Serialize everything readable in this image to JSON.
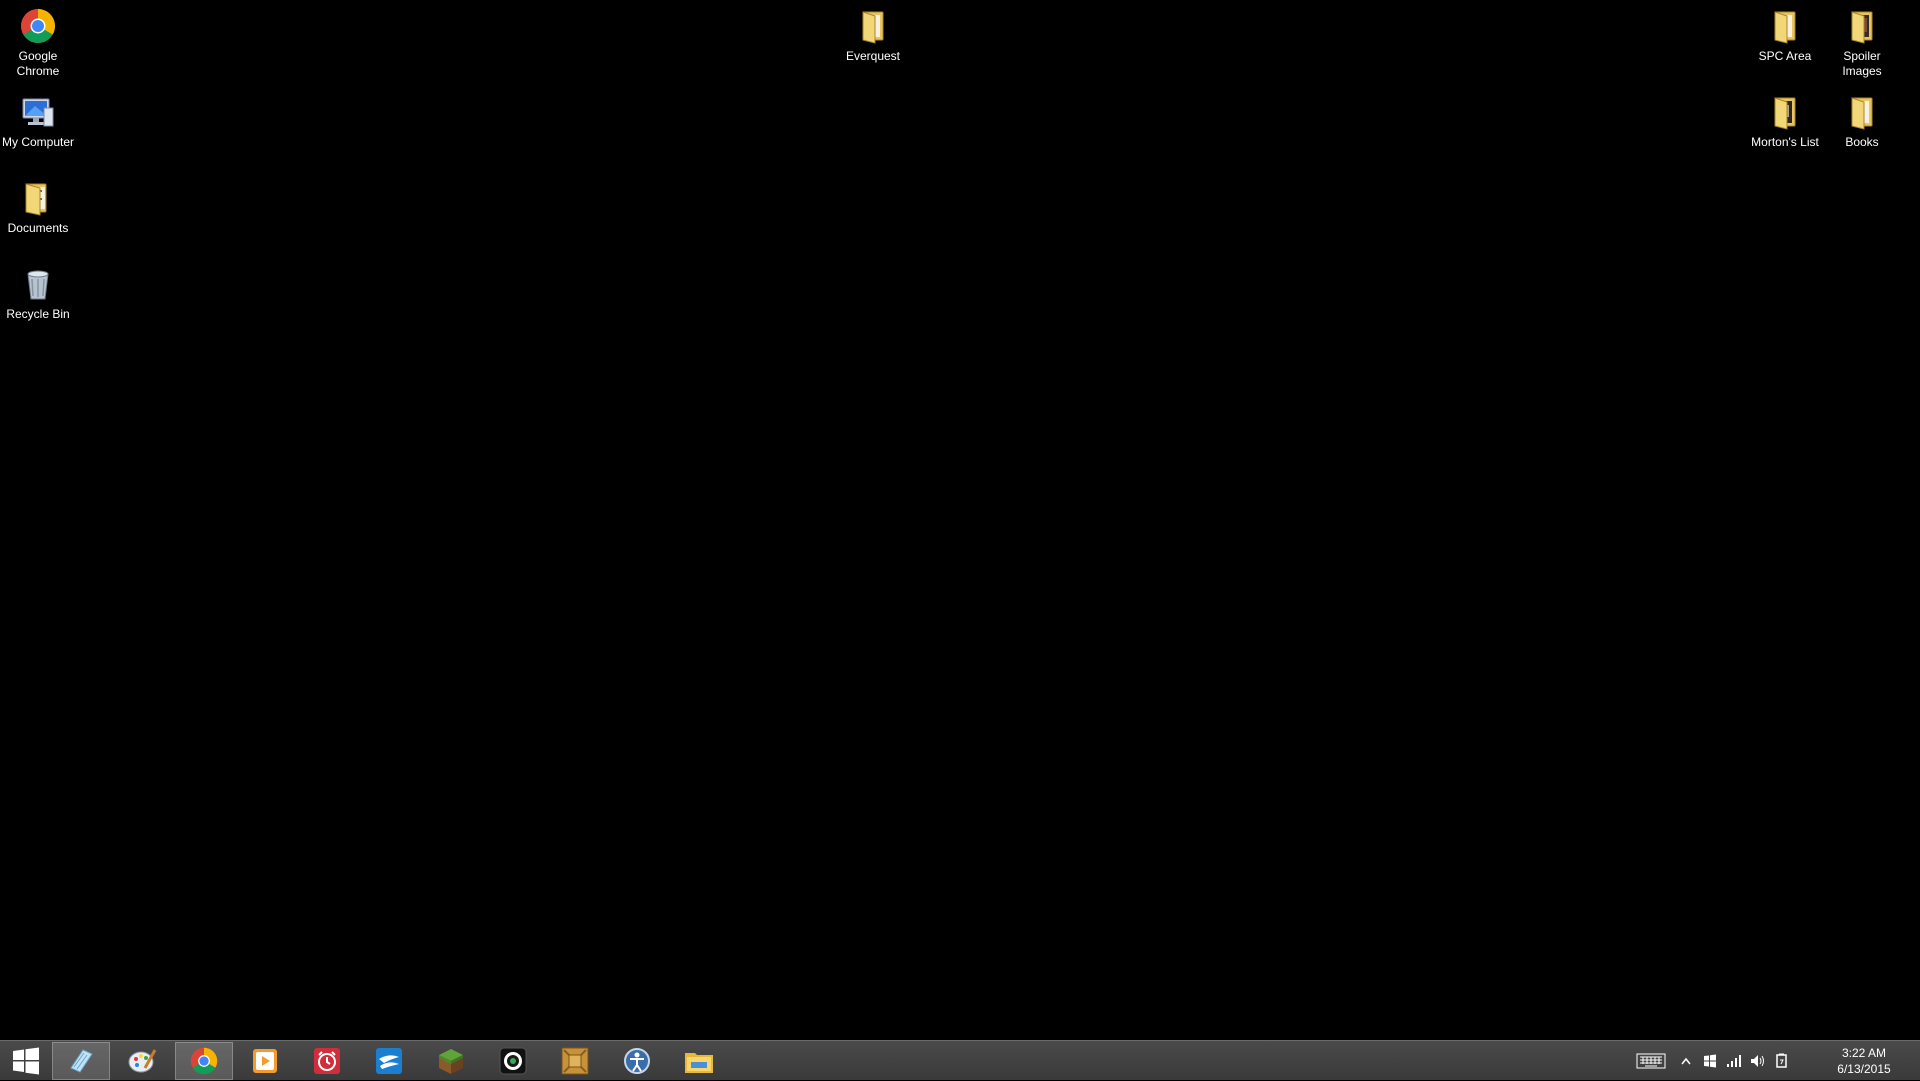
{
  "desktop": {
    "background_color": "#000000",
    "icons": {
      "google_chrome": {
        "label": "Google Chrome",
        "icon": "chrome-icon"
      },
      "my_computer": {
        "label": "My Computer",
        "icon": "computer-icon"
      },
      "documents": {
        "label": "Documents",
        "icon": "folder-icon"
      },
      "recycle_bin": {
        "label": "Recycle Bin",
        "icon": "recycle-bin-icon"
      },
      "everquest": {
        "label": "Everquest",
        "icon": "folder-icon"
      },
      "spc_area": {
        "label": "SPC Area",
        "icon": "folder-icon"
      },
      "spoiler_images": {
        "label": "Spoiler Images",
        "icon": "folder-icon"
      },
      "mortons_list": {
        "label": "Morton's List",
        "icon": "folder-icon"
      },
      "books": {
        "label": "Books",
        "icon": "folder-icon"
      }
    }
  },
  "taskbar": {
    "apps": [
      {
        "icon": "notepad-icon",
        "active": true
      },
      {
        "icon": "paint-icon",
        "active": false
      },
      {
        "icon": "chrome-icon",
        "active": true
      },
      {
        "icon": "media-player-icon",
        "active": false
      },
      {
        "icon": "alarm-clock-icon",
        "active": false
      },
      {
        "icon": "thunderbird-icon",
        "active": false
      },
      {
        "icon": "minecraft-icon",
        "active": false
      },
      {
        "icon": "camera-app-icon",
        "active": false
      },
      {
        "icon": "dosbox-icon",
        "active": false
      },
      {
        "icon": "ease-of-access-icon",
        "active": false
      },
      {
        "icon": "file-explorer-icon",
        "active": false
      }
    ],
    "tray": {
      "icons": [
        "keyboard-icon",
        "show-hidden-icons-icon",
        "action-center-icon",
        "network-signal-icon",
        "volume-icon",
        "power-icon"
      ],
      "time": "3:22 AM",
      "date": "6/13/2015"
    }
  }
}
